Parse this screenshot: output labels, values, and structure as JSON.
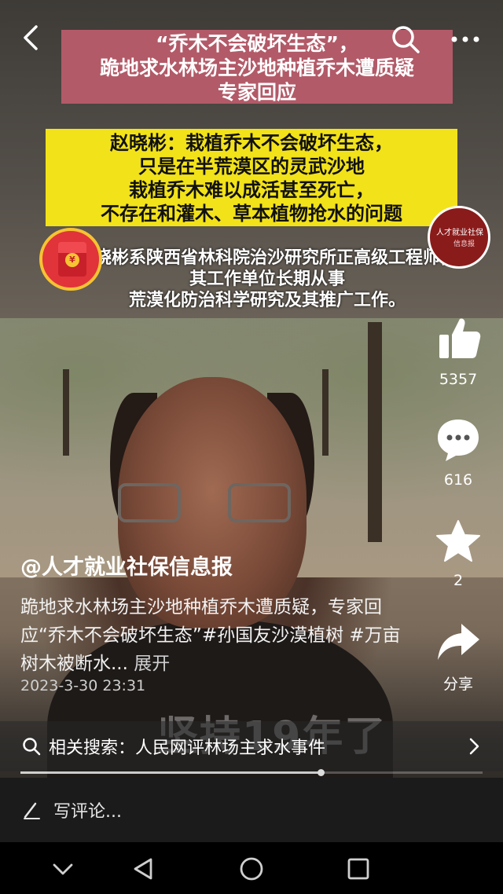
{
  "headline": {
    "line1": "“乔木不会破坏生态”，",
    "line2": "跪地求水林场主沙地种植乔木遭质疑",
    "line3": "专家回应"
  },
  "quote": {
    "line1": "赵晓彬：栽植乔木不会破坏生态，",
    "line2": "只是在半荒漠区的灵武沙地",
    "line3": "栽植乔木难以成活甚至死亡，",
    "line4": "不存在和灌木、草本植物抢水的问题"
  },
  "caption": {
    "line1": "赵晓彬系陕西省林科院治沙研究所正高级工程师，",
    "line2": "其工作单位长期从事",
    "line3": "荒漠化防治科学研究及其推广工作。"
  },
  "video_burned_text": "坚持19年了",
  "avatar_text": {
    "line1": "人才就业社保",
    "line2": "信息报"
  },
  "actions": {
    "likes": "5357",
    "comments": "616",
    "favorites": "2",
    "share_label": "分享"
  },
  "post": {
    "author": "@人才就业社保信息报",
    "description": "跪地求水林场主沙地种植乔木遭质疑，专家回应“乔木不会破坏生态”#孙国友沙漠植树 #万亩树木被断水...",
    "expand_label": "展开",
    "date": "2023-3-30 23:31"
  },
  "related_search": {
    "prefix": "相关搜索：",
    "query": "人民网评林场主求水事件"
  },
  "progress_fraction": 0.65,
  "comment_placeholder": "写评论...",
  "colors": {
    "headline_bg": "#b25a68",
    "quote_bg": "#f2e21a"
  }
}
